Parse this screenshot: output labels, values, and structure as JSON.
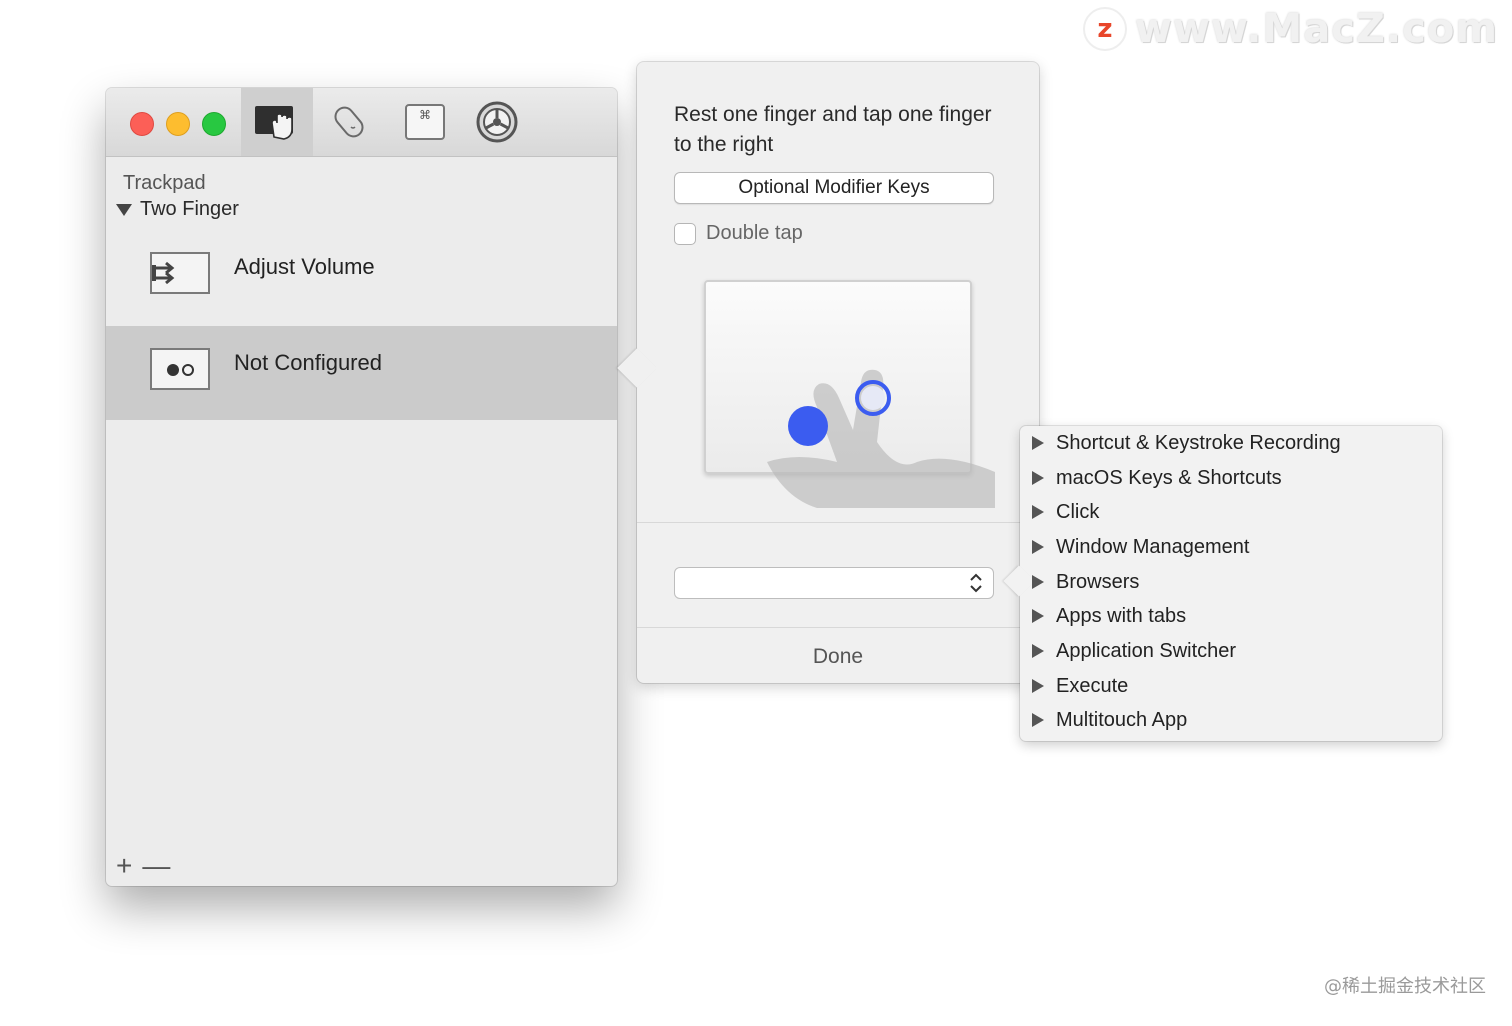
{
  "watermark": {
    "logo_letter": "z",
    "text": "www.MacZ.com",
    "credit": "@稀土掘金技术社区"
  },
  "window": {
    "toolbar": [
      {
        "icon": "trackpad-gesture-icon",
        "active": true
      },
      {
        "icon": "magic-mouse-icon",
        "active": false
      },
      {
        "icon": "keyboard-command-icon",
        "active": false
      },
      {
        "icon": "preferences-gear-icon",
        "active": false
      }
    ],
    "sidebar": {
      "section_label": "Trackpad",
      "group_label": "Two Finger",
      "gestures": [
        {
          "label": "Adjust Volume",
          "icon": "swipe-arrows-icon",
          "selected": false
        },
        {
          "label": "Not Configured",
          "icon": "tap-dots-icon",
          "selected": true
        }
      ]
    },
    "footer": {
      "add_label": "+",
      "remove_label": "—"
    }
  },
  "popover": {
    "instructions": "Rest one finger and tap one finger to the right",
    "modifier_button": "Optional Modifier Keys",
    "double_tap_label": "Double tap",
    "double_tap_checked": false,
    "action_select_value": "",
    "done_label": "Done"
  },
  "action_menu": {
    "items": [
      "Shortcut & Keystroke Recording",
      "macOS Keys & Shortcuts",
      "Click",
      "Window Management",
      "Browsers",
      "Apps with tabs",
      "Application Switcher",
      "Execute",
      "Multitouch App"
    ]
  },
  "colors": {
    "close": "#fc5f57",
    "minimize": "#fdbd2f",
    "zoom": "#28c841",
    "touch_point": "#3b5cf0",
    "selected_row": "#cbcbcb"
  }
}
